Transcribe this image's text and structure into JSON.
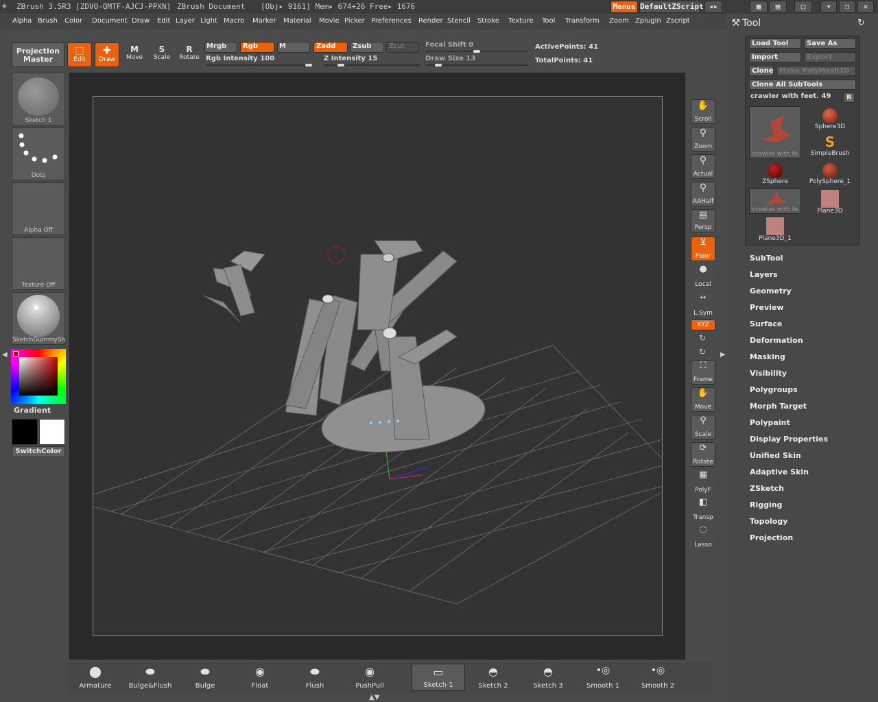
{
  "titlebar": {
    "app": "ZBrush 3.5R3 [ZDVO-QMTF-AJCJ-PPXN]",
    "document": "ZBrush Document",
    "stats": "[Obj▸ 9161] Mem▸ 674+26 Free▸ 1676",
    "menus_button": "Menus",
    "script_button": "DefaultZScript"
  },
  "menubar": [
    "Alpha",
    "Brush",
    "Color",
    "Document",
    "Draw",
    "Edit",
    "Layer",
    "Light",
    "Macro",
    "Marker",
    "Material",
    "Movie",
    "Picker",
    "Preferences",
    "Render",
    "Stencil",
    "Stroke",
    "Texture",
    "Tool",
    "Transform",
    "Zoom",
    "Zplugin",
    "Zscript"
  ],
  "toolbar": {
    "projection_master": "Projection Master",
    "edit": "Edit",
    "draw": "Draw",
    "move": "Move",
    "scale": "Scale",
    "rotate": "Rotate",
    "mrgb": "Mrgb",
    "rgb": "Rgb",
    "m": "M",
    "zadd": "Zadd",
    "zsub": "Zsub",
    "zcut": "Zcut",
    "rgb_intensity": "Rgb Intensity 100",
    "z_intensity": "Z Intensity 15",
    "focal_shift": "Focal Shift 0",
    "draw_size": "Draw Size 13",
    "active_points": "ActivePoints: 41",
    "total_points": "TotalPoints: 41",
    "rgb_intensity_value": 100,
    "z_intensity_value": 15,
    "focal_shift_value": 0,
    "draw_size_value": 13
  },
  "leftpanel": {
    "brush": "Sketch 1",
    "stroke": "Dots",
    "alpha": "Alpha Off",
    "texture": "Texture Off",
    "material": "SketchGummySh",
    "gradient": "Gradient",
    "switch_color": "SwitchColor"
  },
  "rightshelf": [
    "Scroll",
    "Zoom",
    "Actual",
    "AAHalf",
    "Persp",
    "Floor",
    "Local",
    "L.Sym",
    "XYZ",
    "Frame",
    "Move",
    "Scale",
    "Rotate",
    "PolyF",
    "Transp",
    "Lasso"
  ],
  "toolpanel": {
    "title": "Tool",
    "load_tool": "Load Tool",
    "save_as": "Save As",
    "import": "Import",
    "export": "Export",
    "clone": "Clone",
    "make_polymesh": "Make PolyMesh3D",
    "clone_all": "Clone All SubTools",
    "current_tool": "crawler with feet. 49",
    "r_button": "R",
    "tools": [
      "crawler with fe",
      "Sphere3D",
      "SimpleBrush",
      "ZSphere",
      "PolySphere_1",
      "crawler with fe",
      "Plane3D",
      "Plane3D_1"
    ],
    "sections": [
      "SubTool",
      "Layers",
      "Geometry",
      "Preview",
      "Surface",
      "Deformation",
      "Masking",
      "Visibility",
      "Polygroups",
      "Morph Target",
      "Polypaint",
      "Display Properties",
      "Unified Skin",
      "Adaptive Skin",
      "ZSketch",
      "Rigging",
      "Topology",
      "Projection"
    ]
  },
  "bottombar": [
    "Armature",
    "Bulge&Flush",
    "Bulge",
    "Float",
    "Flush",
    "PushPull",
    "Sketch 1",
    "Sketch 2",
    "Sketch 3",
    "Smooth 1",
    "Smooth 2"
  ],
  "colors": {
    "accent": "#e8620f",
    "panel": "#4a4a4a",
    "canvas": "#333333"
  }
}
